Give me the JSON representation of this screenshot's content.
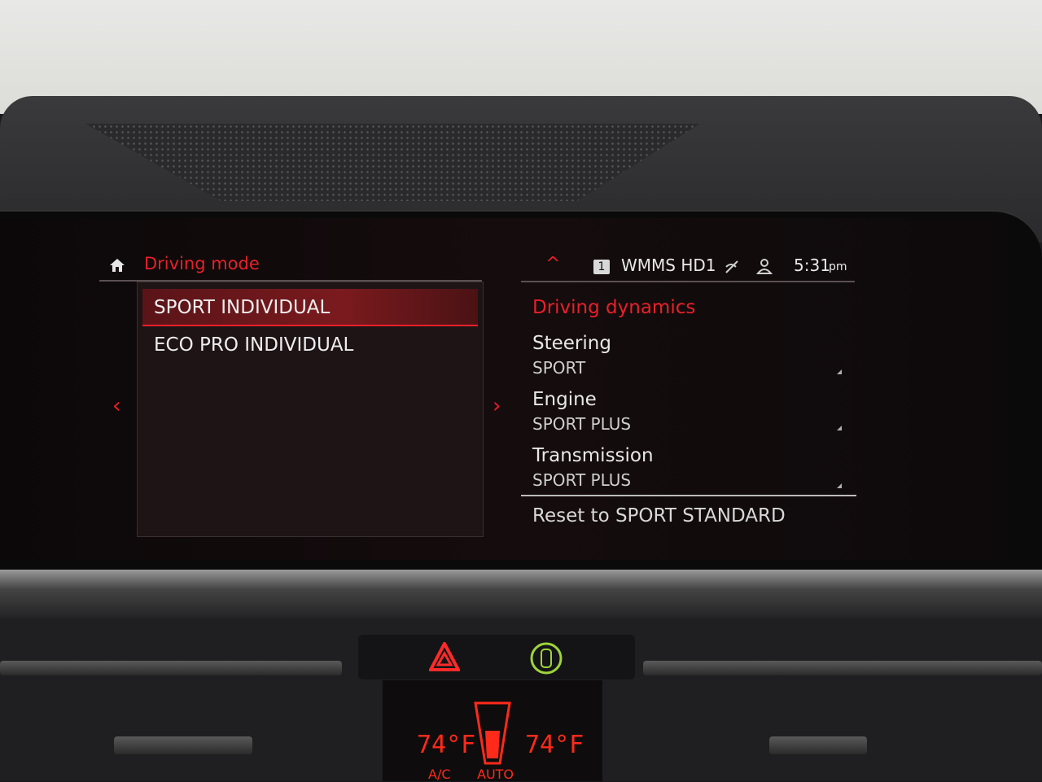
{
  "header": {
    "title": "Driving mode",
    "home_icon": "home-icon"
  },
  "modes": [
    {
      "label": "SPORT INDIVIDUAL",
      "selected": true
    },
    {
      "label": "ECO PRO INDIVIDUAL",
      "selected": false
    }
  ],
  "nav": {
    "left_arrow": "‹",
    "right_arrow": "›"
  },
  "status_bar": {
    "up_arrow": "^",
    "preset": "1",
    "station": "WMMS HD1",
    "time": "5:31",
    "ampm": "pm"
  },
  "dynamics": {
    "title": "Driving dynamics",
    "options": [
      {
        "name": "Steering",
        "value": "SPORT"
      },
      {
        "name": "Engine",
        "value": "SPORT PLUS"
      },
      {
        "name": "Transmission",
        "value": "SPORT PLUS"
      }
    ],
    "reset": "Reset to SPORT STANDARD"
  },
  "climate": {
    "left_temp": "74°F",
    "right_temp": "74°F",
    "ac_label": "A/C",
    "auto_label": "AUTO"
  },
  "colors": {
    "accent": "#e8202a"
  }
}
